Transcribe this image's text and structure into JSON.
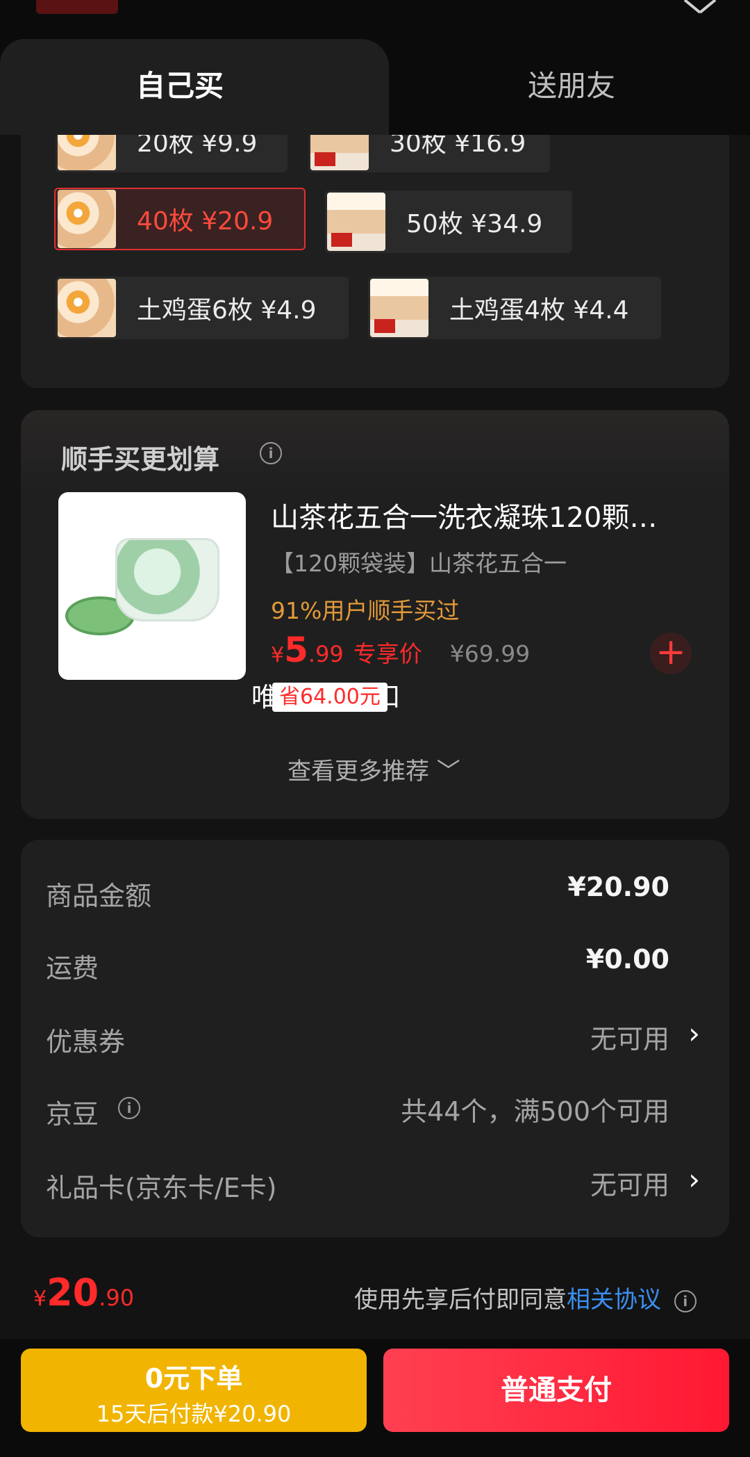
{
  "tabs": {
    "self": "自己买",
    "friend": "送朋友"
  },
  "options": [
    {
      "label": "20枚",
      "price": "¥9.9"
    },
    {
      "label": "30枚",
      "price": "¥16.9"
    },
    {
      "label": "40枚",
      "price": "¥20.9",
      "selected": true
    },
    {
      "label": "50枚",
      "price": "¥34.9"
    },
    {
      "label": "土鸡蛋6枚",
      "price": "¥4.9"
    },
    {
      "label": "土鸡蛋4枚",
      "price": "¥4.4"
    }
  ],
  "bundle": {
    "title": "顺手买更划算",
    "product_name": "山茶花五合一洗衣凝珠120颗…",
    "product_sub": "【120颗袋装】山茶花五合一",
    "stat": "91%用户顺手买过",
    "price_currency": "¥",
    "price_int": "5",
    "price_dec": ".99",
    "price_tag": "专享价",
    "orig_price": "¥69.99",
    "overlay_text": "唯    合    护折扣",
    "coupon_badge": "省64.00元",
    "see_more": "查看更多推荐 ﹀"
  },
  "summary": {
    "goods_label": "商品金额",
    "goods_value": "¥20.90",
    "shipping_label": "运费",
    "shipping_value": "¥0.00",
    "coupon_label": "优惠券",
    "coupon_value": "无可用",
    "jingdou_label": "京豆",
    "jingdou_value": "共44个，满500个可用",
    "giftcard_label": "礼品卡(京东卡/E卡)",
    "giftcard_value": "无可用"
  },
  "total": {
    "currency": "¥",
    "int": "20",
    "dec": ".90"
  },
  "agreement": {
    "text": "使用先享后付即同意",
    "link": "相关协议"
  },
  "buttons": {
    "later_title": "0元下单",
    "later_sub": "15天后付款¥20.90",
    "pay": "普通支付"
  },
  "colors": {
    "accent_red": "#ff2a2a",
    "yellow": "#f1b400",
    "link_blue": "#3b8ff0"
  }
}
